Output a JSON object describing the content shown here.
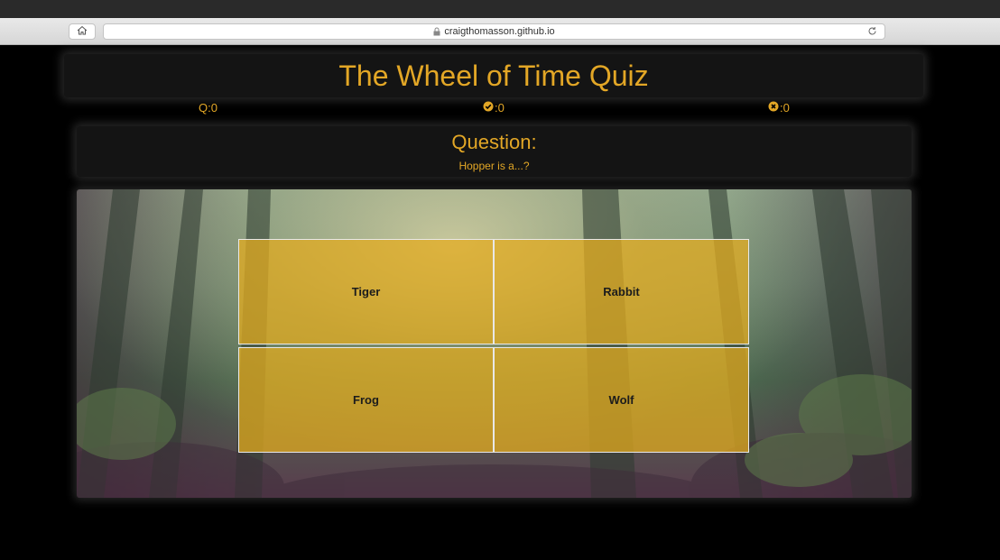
{
  "browser": {
    "url": "craigthomasson.github.io",
    "icons": {
      "home": "home-icon",
      "lock": "lock-icon",
      "reload": "reload-icon"
    }
  },
  "quiz": {
    "title": "The Wheel of Time Quiz",
    "score": {
      "questions": "Q:0",
      "correct": ":0",
      "wrong": ":0"
    },
    "question_heading": "Question:",
    "question_text": "Hopper is a...?",
    "answers": [
      "Tiger",
      "Rabbit",
      "Frog",
      "Wolf"
    ]
  },
  "colors": {
    "accent": "#e3a726",
    "answer_fill": "#e4ac1e",
    "panel": "#141414"
  }
}
